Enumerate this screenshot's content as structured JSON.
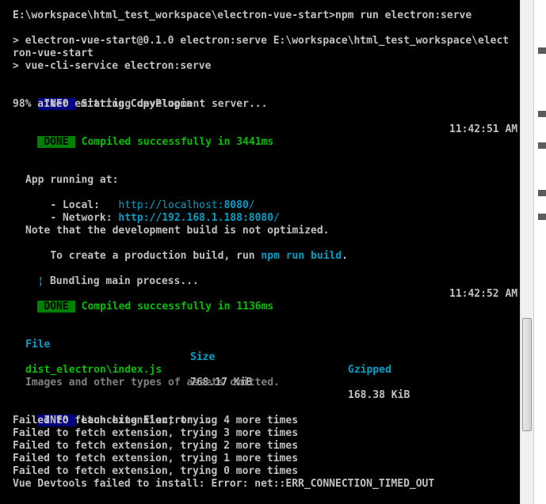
{
  "terminal": {
    "line_cmd": "E:\\workspace\\html_test_workspace\\electron-vue-start>npm run electron:serve",
    "line_run1": "> electron-vue-start@0.1.0 electron:serve E:\\workspace\\html_test_workspace\\elect",
    "line_run2": "ron-vue-start",
    "line_run3": "> vue-cli-service electron:serve",
    "info_tag": "INFO",
    "done_tag": "DONE",
    "starting": "Starting development server...",
    "progress": "98% after emitting CopyPlugin",
    "compiled1": "Compiled successfully in 3441ms",
    "time1": "11:42:51 AM",
    "app_running": "App running at:",
    "local_label": "- Local:   ",
    "local_url_a": "http://localhost:",
    "local_port": "8080",
    "local_url_b": "/",
    "network_label": "- Network: ",
    "network_url_a": "http://192.168.1.188:",
    "network_port": "8080",
    "network_url_b": "/",
    "note1": "Note that the development build is not optimized.",
    "note2_a": "To create a production build, run ",
    "note2_cmd": "npm run build",
    "note2_b": ".",
    "spinner": "¦",
    "bundling": " Bundling main process...",
    "compiled2": "Compiled successfully in 1136ms",
    "time2": "11:42:52 AM",
    "table": {
      "headers": [
        "File",
        "Size",
        "Gzipped"
      ],
      "rows": [
        {
          "file": "dist_electron\\index.js",
          "size": "768.17 KiB",
          "gzipped": "168.38 KiB"
        }
      ]
    },
    "assets_omitted": "Images and other types of assets omitted.",
    "launching": "Launching Electron...",
    "fail4": "Failed to fetch extension, trying 4 more times",
    "fail3": "Failed to fetch extension, trying 3 more times",
    "fail2": "Failed to fetch extension, trying 2 more times",
    "fail1": "Failed to fetch extension, trying 1 more times",
    "fail0": "Failed to fetch extension, trying 0 more times",
    "devtools_error": "Vue Devtools failed to install: Error: net::ERR_CONNECTION_TIMED_OUT"
  },
  "colors": {
    "background": "#000000",
    "text": "#c0c0c0",
    "success": "#00c000",
    "link": "#00a0c8",
    "info_bg": "#000080",
    "done_bg": "#008000"
  }
}
